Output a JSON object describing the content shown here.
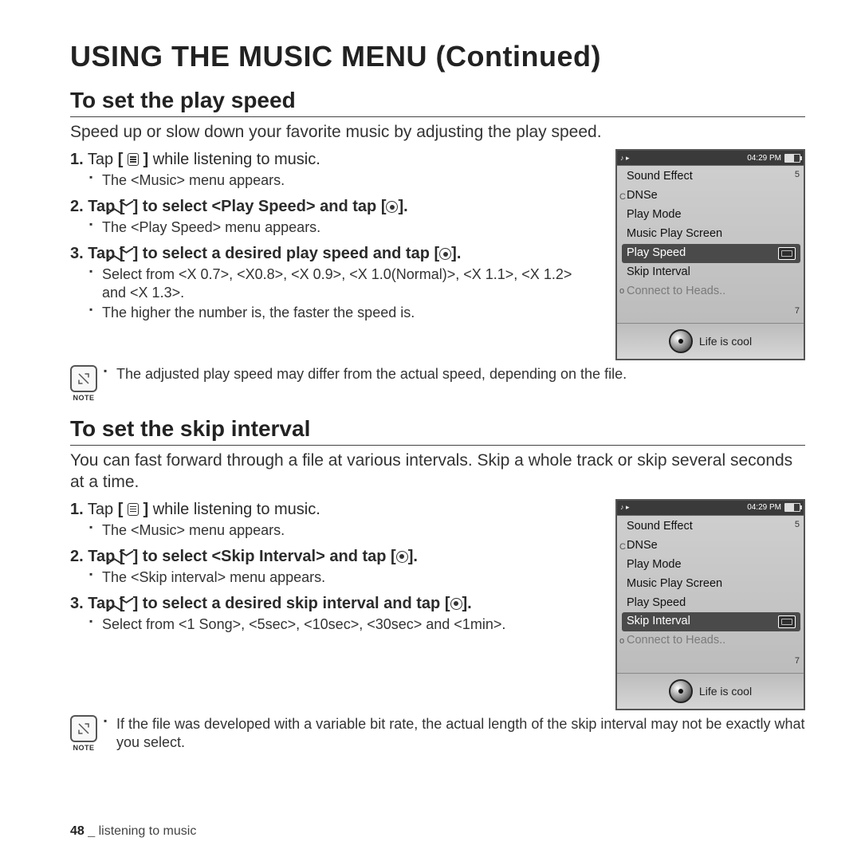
{
  "page": {
    "title": "USING THE MUSIC MENU (Continued)",
    "number": "48",
    "section_label": "listening to music",
    "note_label": "NOTE"
  },
  "icons": {
    "menu_alt": "menu",
    "updown_alt": "up/down",
    "ok_alt": "select"
  },
  "sec1": {
    "heading": "To set the play speed",
    "intro": "Speed up or slow down your favorite music by adjusting the play speed.",
    "step1": {
      "num": "1.",
      "a": "Tap ",
      "b": " while listening to music.",
      "sub": "The <Music> menu appears."
    },
    "step2": {
      "num": "2.",
      "a": "Tap ",
      "b": " to select ",
      "target": "<Play Speed>",
      "c": " and tap ",
      "d": ".",
      "sub": "The <Play Speed> menu appears."
    },
    "step3": {
      "num": "3.",
      "a": "Tap ",
      "b": " to select a desired play speed and tap ",
      "c": ".",
      "sub_a": "Select from <X 0.7>, <X0.8>, <X 0.9>, <X 1.0(Normal)>, <X 1.1>, <X 1.2> and <X 1.3>.",
      "sub_b": "The higher the number is, the faster the speed is."
    },
    "note": "The adjusted play speed may differ from the actual speed, depending on the file."
  },
  "sec2": {
    "heading": "To set the skip interval",
    "intro": "You can fast forward through a file at various intervals. Skip a whole track or skip several seconds at a time.",
    "step1": {
      "num": "1.",
      "a": "Tap ",
      "b": " while listening to music.",
      "sub": "The <Music> menu appears."
    },
    "step2": {
      "num": "2.",
      "a": "Tap ",
      "b": " to select ",
      "target": "<Skip Interval>",
      "c": " and tap ",
      "d": ".",
      "sub": "The <Skip interval> menu appears."
    },
    "step3": {
      "num": "3.",
      "a": "Tap ",
      "b": " to select a desired skip interval and tap ",
      "c": ".",
      "sub_a": "Select from <1 Song>, <5sec>, <10sec>, <30sec> and <1min>."
    },
    "note": "If the file was developed with a variable bit rate, the actual length of the skip interval may not be exactly what you select."
  },
  "device": {
    "clock": "04:29 PM",
    "items": [
      "Sound Effect",
      "DNSe",
      "Play Mode",
      "Music Play Screen",
      "Play Speed",
      "Skip Interval",
      "Connect to Heads.."
    ],
    "track": "Life is cool",
    "n5": "5",
    "n7": "7",
    "bumpA": "C",
    "bumpB": "o"
  },
  "dev1_selected": "Play Speed",
  "dev2_selected": "Skip Interval"
}
